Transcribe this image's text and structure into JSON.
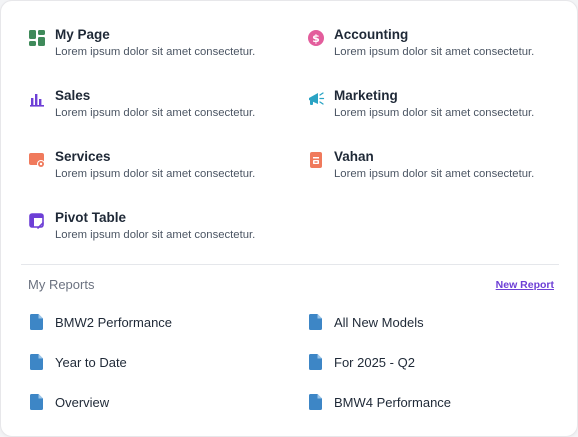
{
  "modules": [
    {
      "title": "My Page",
      "description": "Lorem ipsum dolor sit amet consectetur.",
      "icon": "dashboard-icon",
      "color": "#3f8a5a"
    },
    {
      "title": "Accounting",
      "description": "Lorem ipsum dolor sit amet consectetur.",
      "icon": "dollar-coin-icon",
      "color": "#e35d9c"
    },
    {
      "title": "Sales",
      "description": "Lorem ipsum dolor sit amet consectetur.",
      "icon": "bar-chart-icon",
      "color": "#6d3fd6"
    },
    {
      "title": "Marketing",
      "description": "Lorem ipsum dolor sit amet consectetur.",
      "icon": "megaphone-icon",
      "color": "#2aa3c4"
    },
    {
      "title": "Services",
      "description": "Lorem ipsum dolor sit amet consectetur.",
      "icon": "service-gear-icon",
      "color": "#f07a5c"
    },
    {
      "title": "Vahan",
      "description": "Lorem ipsum dolor sit amet consectetur.",
      "icon": "vehicle-doc-icon",
      "color": "#f07a5c"
    },
    {
      "title": "Pivot Table",
      "description": "Lorem ipsum dolor sit amet consectetur.",
      "icon": "pivot-table-icon",
      "color": "#6d3fd6"
    }
  ],
  "reports": {
    "title": "My Reports",
    "new_report_label": "New Report",
    "doc_icon_color": "#3d86c6",
    "items": [
      {
        "label": "BMW2 Performance"
      },
      {
        "label": "All New Models"
      },
      {
        "label": "Year to Date"
      },
      {
        "label": "For 2025 - Q2"
      },
      {
        "label": "Overview"
      },
      {
        "label": "BMW4 Performance"
      }
    ]
  }
}
